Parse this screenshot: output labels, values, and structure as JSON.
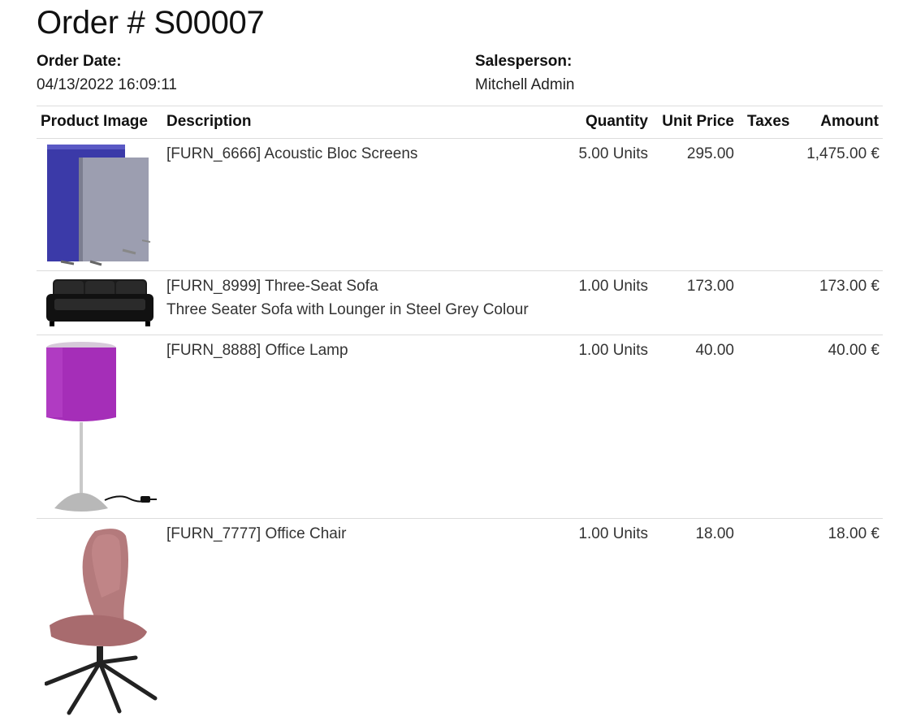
{
  "order": {
    "title": "Order # S00007",
    "order_date_label": "Order Date:",
    "order_date": "04/13/2022 16:09:11",
    "salesperson_label": "Salesperson:",
    "salesperson": "Mitchell Admin"
  },
  "table": {
    "headers": {
      "image": "Product Image",
      "description": "Description",
      "quantity": "Quantity",
      "unit_price": "Unit Price",
      "taxes": "Taxes",
      "amount": "Amount"
    },
    "rows": [
      {
        "name": "[FURN_6666] Acoustic Bloc Screens",
        "note": "",
        "quantity": "5.00 Units",
        "unit_price": "295.00",
        "taxes": "",
        "amount": "1,475.00 €",
        "image_icon": "acoustic-screens-image"
      },
      {
        "name": "[FURN_8999] Three-Seat Sofa",
        "note": "Three Seater Sofa with Lounger in Steel Grey Colour",
        "quantity": "1.00 Units",
        "unit_price": "173.00",
        "taxes": "",
        "amount": "173.00 €",
        "image_icon": "sofa-image"
      },
      {
        "name": "[FURN_8888] Office Lamp",
        "note": "",
        "quantity": "1.00 Units",
        "unit_price": "40.00",
        "taxes": "",
        "amount": "40.00 €",
        "image_icon": "lamp-image"
      },
      {
        "name": "[FURN_7777] Office Chair",
        "note": "",
        "quantity": "1.00 Units",
        "unit_price": "18.00",
        "taxes": "",
        "amount": "18.00 €",
        "image_icon": "chair-image"
      }
    ]
  }
}
